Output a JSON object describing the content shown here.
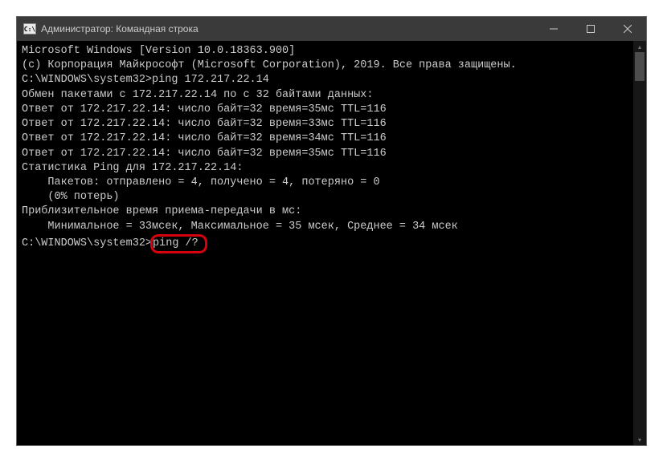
{
  "window": {
    "title": "Администратор: Командная строка",
    "icon_label": "C:\\"
  },
  "terminal": {
    "line1": "Microsoft Windows [Version 10.0.18363.900]",
    "line2": "(c) Корпорация Майкрософт (Microsoft Corporation), 2019. Все права защищены.",
    "blank1": "",
    "prompt1_path": "C:\\WINDOWS\\system32>",
    "prompt1_cmd": "ping 172.217.22.14",
    "blank2": "",
    "exchange": "Обмен пакетами с 172.217.22.14 по с 32 байтами данных:",
    "reply1": "Ответ от 172.217.22.14: число байт=32 время=35мс TTL=116",
    "reply2": "Ответ от 172.217.22.14: число байт=32 время=33мс TTL=116",
    "reply3": "Ответ от 172.217.22.14: число байт=32 время=34мс TTL=116",
    "reply4": "Ответ от 172.217.22.14: число байт=32 время=35мс TTL=116",
    "blank3": "",
    "stats_header": "Статистика Ping для 172.217.22.14:",
    "stats_packets": "    Пакетов: отправлено = 4, получено = 4, потеряно = 0",
    "stats_loss": "    (0% потерь)",
    "rtt_header": "Приблизительное время приема-передачи в мс:",
    "rtt_values": "    Минимальное = 33мсек, Максимальное = 35 мсек, Среднее = 34 мсек",
    "blank4": "",
    "prompt2_path": "C:\\WINDOWS\\system32>",
    "prompt2_cmd": "ping /?"
  }
}
